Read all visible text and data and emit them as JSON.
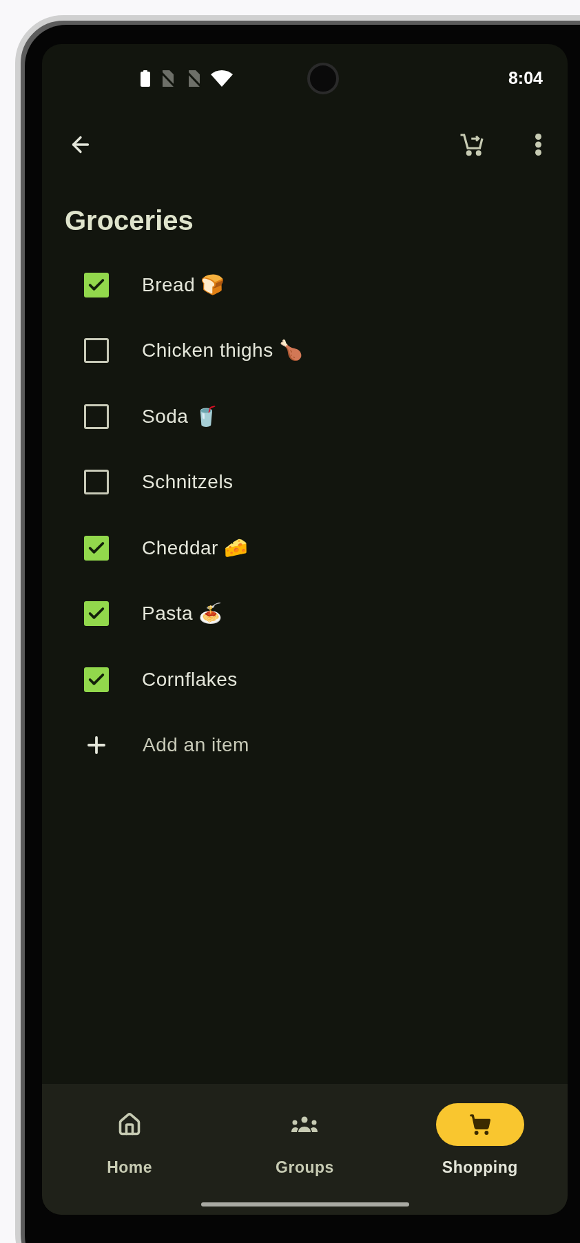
{
  "status_bar": {
    "time": "8:04"
  },
  "title": "Groceries",
  "items": [
    {
      "label": "Bread 🍞",
      "checked": true
    },
    {
      "label": "Chicken thighs 🍗",
      "checked": false
    },
    {
      "label": "Soda 🥤",
      "checked": false
    },
    {
      "label": "Schnitzels",
      "checked": false
    },
    {
      "label": "Cheddar 🧀",
      "checked": true
    },
    {
      "label": "Pasta 🍝",
      "checked": true
    },
    {
      "label": "Cornflakes",
      "checked": true
    }
  ],
  "add_item": {
    "label": "Add an item"
  },
  "nav": [
    {
      "kind": "home",
      "label": "Home",
      "selected": false
    },
    {
      "kind": "groups",
      "label": "Groups",
      "selected": false
    },
    {
      "kind": "shopping",
      "label": "Shopping",
      "selected": true
    }
  ]
}
